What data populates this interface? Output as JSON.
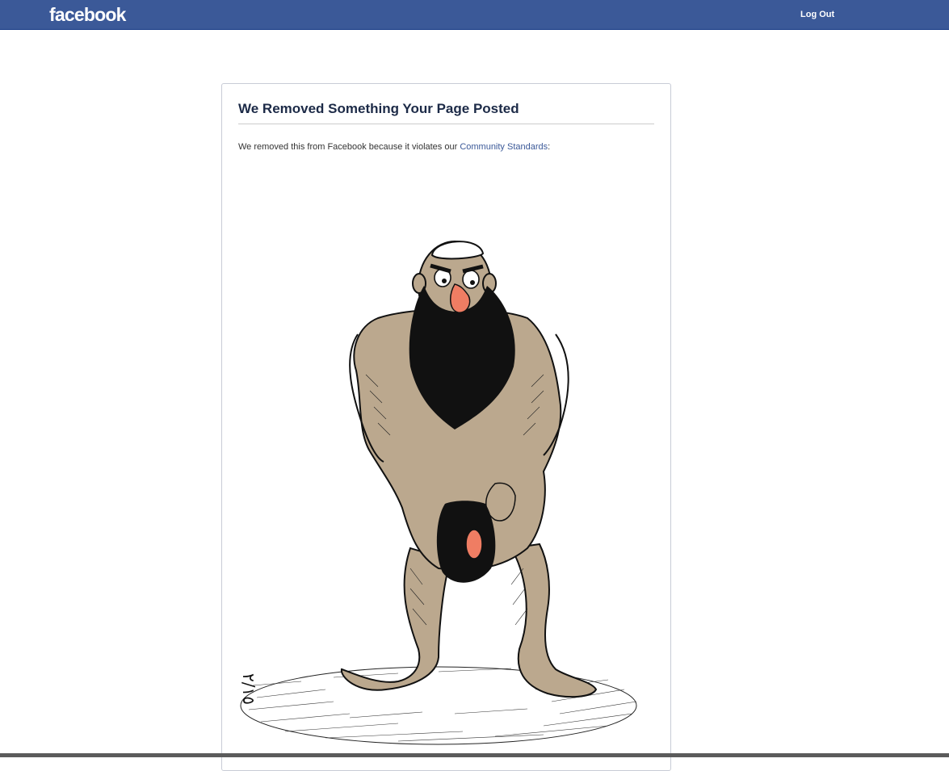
{
  "header": {
    "logo": "facebook",
    "logout_label": "Log Out"
  },
  "notice": {
    "title": "We Removed Something Your Page Posted",
    "message_prefix": "We removed this from Facebook because it violates our ",
    "link_label": "Community Standards",
    "message_suffix": ":"
  },
  "removed_content": {
    "type": "image",
    "signature_text": "٢/١٥"
  },
  "colors": {
    "header_bg": "#3b5998",
    "link": "#3b5998",
    "title": "#1c2a47",
    "skin": "#bba88e",
    "beard": "#111111",
    "nose": "#ef7d63"
  }
}
